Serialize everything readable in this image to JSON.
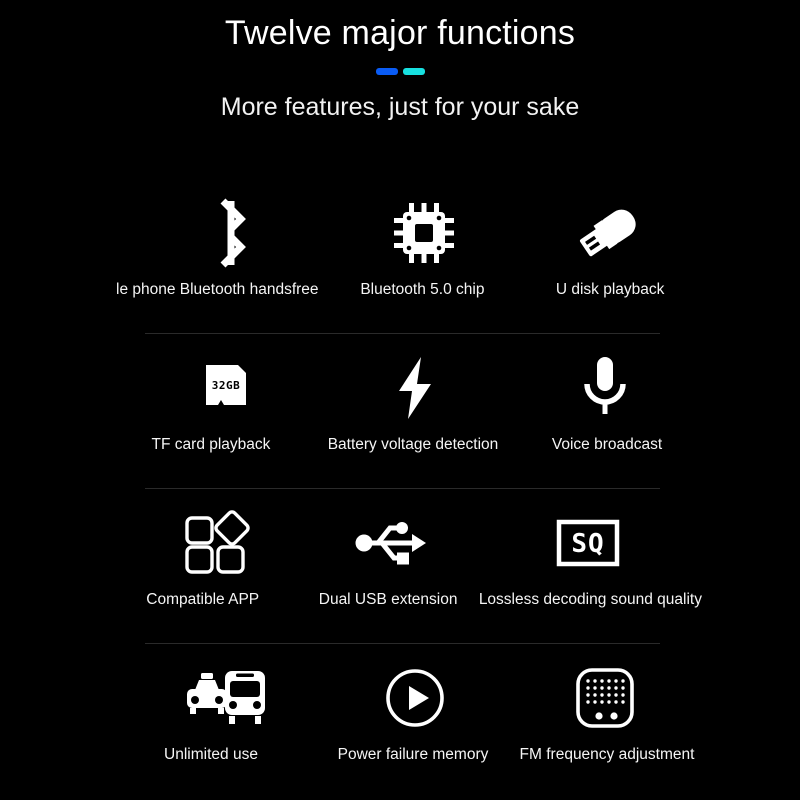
{
  "header": {
    "title": "Twelve major functions",
    "subtitle": "More features, just for your sake",
    "accent_primary": "#0a5cf5",
    "accent_secondary": "#17e0e0"
  },
  "theme": {
    "background": "#000000",
    "text": "#ffffff",
    "divider": "#2a2a2a",
    "icon": "#ffffff"
  },
  "features": {
    "rows": [
      {
        "cells": [
          {
            "icon": "bluetooth-icon",
            "label": "le phone Bluetooth handsfree"
          },
          {
            "icon": "chip-icon",
            "label": "Bluetooth 5.0 chip"
          },
          {
            "icon": "usb-flash-drive-icon",
            "label": "U disk playback"
          }
        ]
      },
      {
        "cells": [
          {
            "icon": "microsd-card-icon",
            "label": "TF card playback",
            "badge": "32GB"
          },
          {
            "icon": "lightning-bolt-icon",
            "label": "Battery voltage detection"
          },
          {
            "icon": "microphone-icon",
            "label": "Voice broadcast"
          }
        ]
      },
      {
        "cells": [
          {
            "icon": "app-grid-icon",
            "label": "Compatible APP"
          },
          {
            "icon": "usb-trident-icon",
            "label": "Dual USB extension"
          },
          {
            "icon": "sound-quality-icon",
            "label": "Lossless decoding sound quality",
            "badge": "SQ"
          }
        ]
      },
      {
        "cells": [
          {
            "icon": "taxi-bus-icon",
            "label": "Unlimited use"
          },
          {
            "icon": "play-circle-icon",
            "label": "Power failure memory"
          },
          {
            "icon": "fm-radio-icon",
            "label": "FM frequency adjustment"
          }
        ]
      }
    ]
  }
}
